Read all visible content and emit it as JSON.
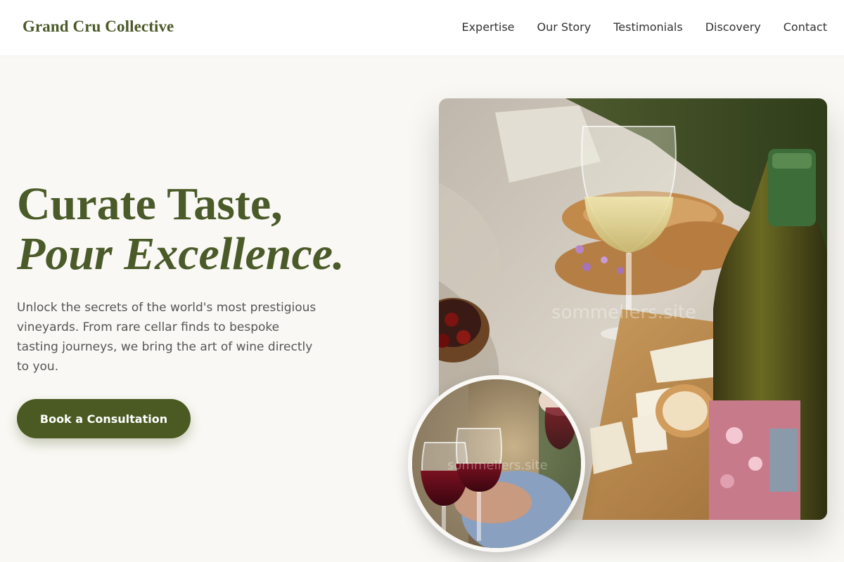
{
  "header": {
    "brand": "Grand Cru Collective",
    "nav": [
      "Expertise",
      "Our Story",
      "Testimonials",
      "Discovery",
      "Contact"
    ]
  },
  "hero": {
    "title_line1": "Curate Taste,",
    "title_line2": "Pour Excellence.",
    "description": "Unlock the secrets of the world's most prestigious vineyards. From rare cellar finds to bespoke tasting journeys, we bring the art of wine directly to you.",
    "cta_label": "Book a Consultation"
  },
  "images": {
    "main_watermark": "sommeliers.site",
    "circle_watermark": "sommeliers.site"
  },
  "colors": {
    "accent": "#4a5a28",
    "button": "#4a5a22",
    "background": "#f9f8f4"
  }
}
